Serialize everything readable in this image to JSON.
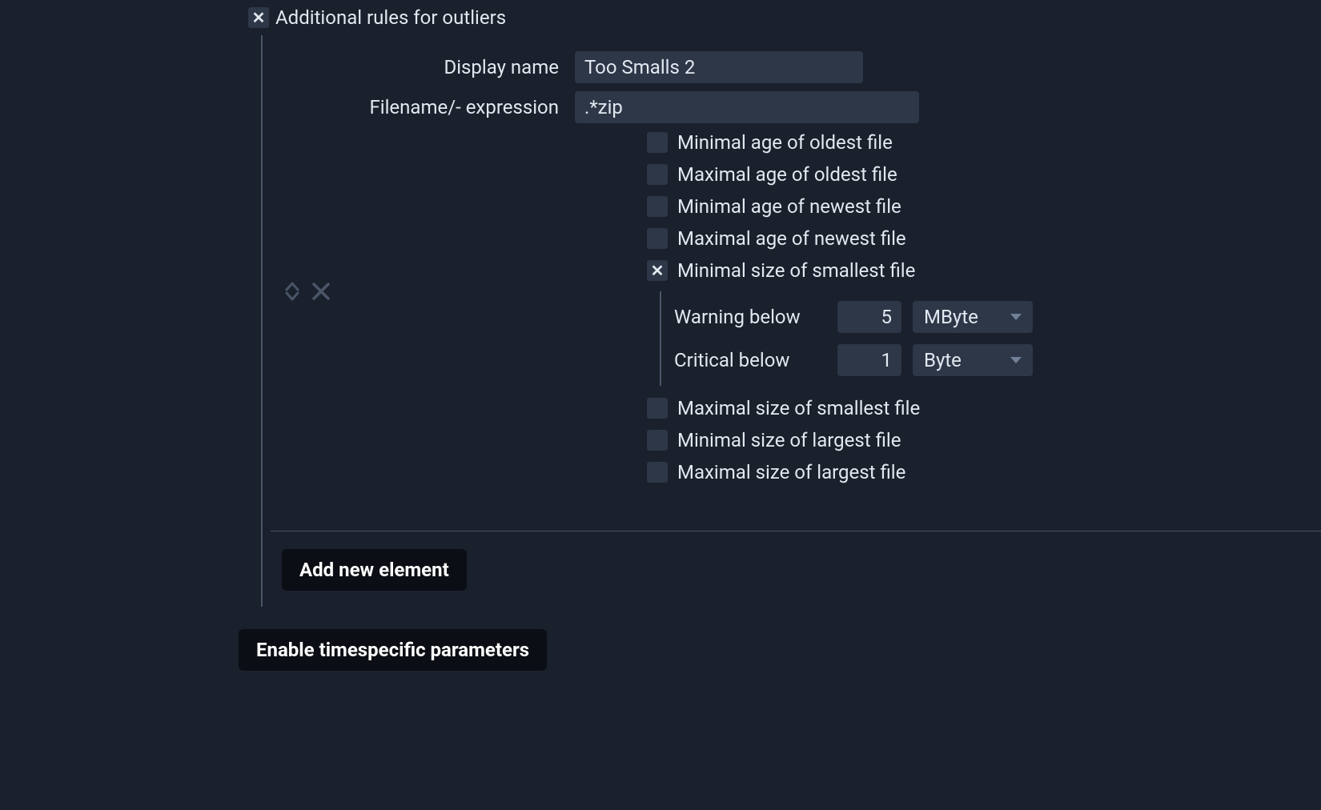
{
  "section": {
    "title": "Additional rules for outliers"
  },
  "rule": {
    "display_name_label": "Display name",
    "display_name_value": "Too Smalls 2",
    "filename_label": "Filename/- expression",
    "filename_value": ".*zip",
    "options": {
      "min_age_oldest": "Minimal age of oldest file",
      "max_age_oldest": "Maximal age of oldest file",
      "min_age_newest": "Minimal age of newest file",
      "max_age_newest": "Maximal age of newest file",
      "min_size_smallest": "Minimal size of smallest file",
      "max_size_smallest": "Maximal size of smallest file",
      "min_size_largest": "Minimal size of largest file",
      "max_size_largest": "Maximal size of largest file"
    },
    "thresholds": {
      "warning_label": "Warning below",
      "warning_value": "5",
      "warning_unit": "MByte",
      "critical_label": "Critical below",
      "critical_value": "1",
      "critical_unit": "Byte"
    }
  },
  "buttons": {
    "add_new": "Add new element",
    "enable_timespecific": "Enable timespecific parameters"
  }
}
